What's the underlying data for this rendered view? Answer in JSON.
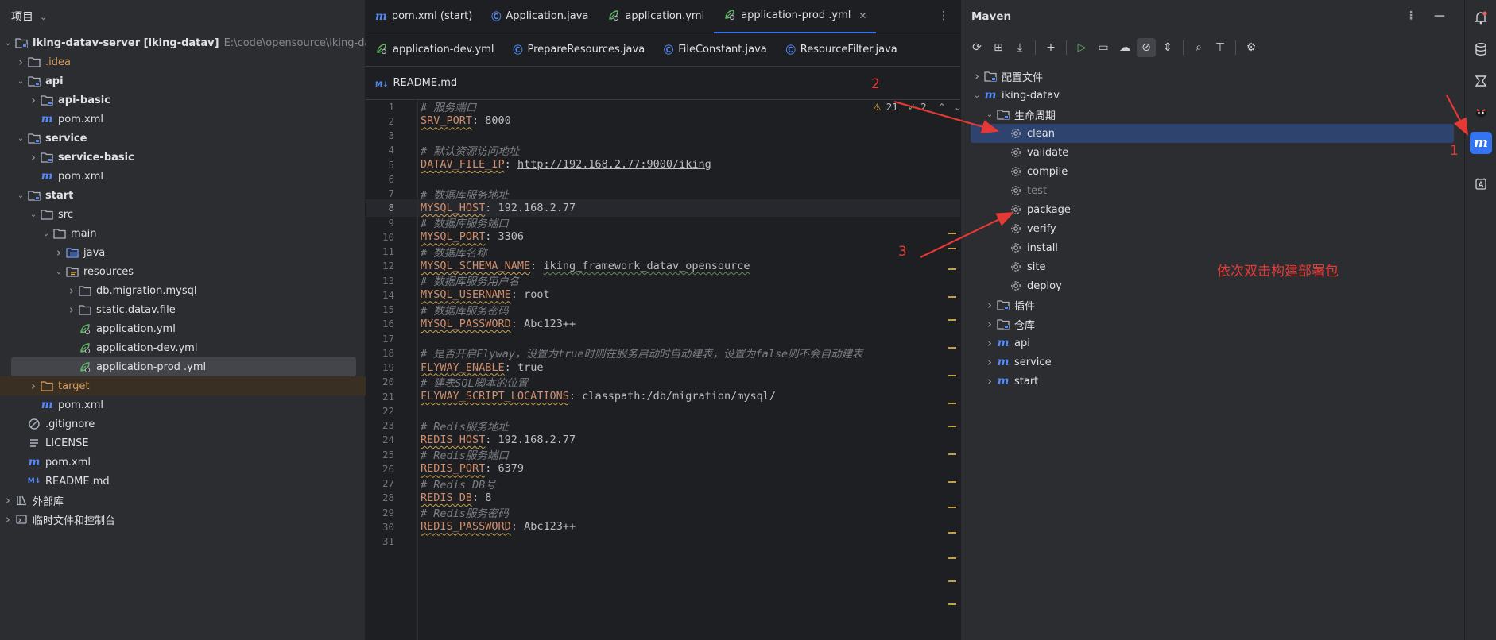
{
  "project_panel": {
    "title": "项目",
    "rows": [
      {
        "label": "iking-datav-server [iking-datav]",
        "path": "E:\\code\\opensource\\iking-datav-server",
        "depth": 0,
        "arrow": "down",
        "icon": "module-folder",
        "bold": true
      },
      {
        "label": ".idea",
        "depth": 1,
        "arrow": "right",
        "icon": "folder",
        "orange": true
      },
      {
        "label": "api",
        "depth": 1,
        "arrow": "down",
        "icon": "module-folder",
        "bold": true
      },
      {
        "label": "api-basic",
        "depth": 2,
        "arrow": "right",
        "icon": "module-folder",
        "bold": true
      },
      {
        "label": "pom.xml",
        "depth": 2,
        "arrow": "",
        "icon": "maven"
      },
      {
        "label": "service",
        "depth": 1,
        "arrow": "down",
        "icon": "module-folder",
        "bold": true
      },
      {
        "label": "service-basic",
        "depth": 2,
        "arrow": "right",
        "icon": "module-folder",
        "bold": true
      },
      {
        "label": "pom.xml",
        "depth": 2,
        "arrow": "",
        "icon": "maven"
      },
      {
        "label": "start",
        "depth": 1,
        "arrow": "down",
        "icon": "module-folder",
        "bold": true
      },
      {
        "label": "src",
        "depth": 2,
        "arrow": "down",
        "icon": "folder"
      },
      {
        "label": "main",
        "depth": 3,
        "arrow": "down",
        "icon": "folder"
      },
      {
        "label": "java",
        "depth": 4,
        "arrow": "right",
        "icon": "source-folder"
      },
      {
        "label": "resources",
        "depth": 4,
        "arrow": "down",
        "icon": "resource-folder"
      },
      {
        "label": "db.migration.mysql",
        "depth": 5,
        "arrow": "right",
        "icon": "folder"
      },
      {
        "label": "static.datav.file",
        "depth": 5,
        "arrow": "right",
        "icon": "folder"
      },
      {
        "label": "application.yml",
        "depth": 5,
        "arrow": "",
        "icon": "yaml"
      },
      {
        "label": "application-dev.yml",
        "depth": 5,
        "arrow": "",
        "icon": "yaml"
      },
      {
        "label": "application-prod .yml",
        "depth": 5,
        "arrow": "",
        "icon": "yaml",
        "selected": true
      },
      {
        "label": "target",
        "depth": 2,
        "arrow": "right",
        "icon": "folder-orange",
        "orange": true,
        "highlight": "target"
      },
      {
        "label": "pom.xml",
        "depth": 2,
        "arrow": "",
        "icon": "maven"
      },
      {
        "label": ".gitignore",
        "depth": 1,
        "arrow": "",
        "icon": "ignore"
      },
      {
        "label": "LICENSE",
        "depth": 1,
        "arrow": "",
        "icon": "text"
      },
      {
        "label": "pom.xml",
        "depth": 1,
        "arrow": "",
        "icon": "maven"
      },
      {
        "label": "README.md",
        "depth": 1,
        "arrow": "",
        "icon": "markdown"
      },
      {
        "label": "外部库",
        "depth": 0,
        "arrow": "right",
        "icon": "library"
      },
      {
        "label": "临时文件和控制台",
        "depth": 0,
        "arrow": "right",
        "icon": "console"
      }
    ]
  },
  "editor": {
    "tabs_row1": [
      {
        "label": "pom.xml (start)",
        "icon": "maven"
      },
      {
        "label": "Application.java",
        "icon": "class"
      },
      {
        "label": "application.yml",
        "icon": "yaml"
      },
      {
        "label": "application-prod .yml",
        "icon": "yaml",
        "active": true
      }
    ],
    "tabs_row2": [
      {
        "label": "application-dev.yml",
        "icon": "yaml"
      },
      {
        "label": "PrepareResources.java",
        "icon": "class"
      },
      {
        "label": "FileConstant.java",
        "icon": "class"
      },
      {
        "label": "ResourceFilter.java",
        "icon": "class"
      }
    ],
    "tabs_row3": [
      {
        "label": "README.md",
        "icon": "markdown"
      }
    ],
    "inspections": {
      "warnings": "21",
      "weak": "2"
    },
    "current_line": 8,
    "lines": [
      {
        "n": "1",
        "comment": "# 服务端口"
      },
      {
        "n": "2",
        "key": "SRV_PORT",
        "value": "8000"
      },
      {
        "n": "3"
      },
      {
        "n": "4",
        "comment": "# 默认资源访问地址"
      },
      {
        "n": "5",
        "key": "DATAV_FILE_IP",
        "value": "http://192.168.2.77:9000/iking",
        "url": true
      },
      {
        "n": "6"
      },
      {
        "n": "7",
        "comment": "# 数据库服务地址"
      },
      {
        "n": "8",
        "key": "MYSQL_HOST",
        "value": "192.168.2.77"
      },
      {
        "n": "9",
        "comment": "# 数据库服务端口"
      },
      {
        "n": "10",
        "key": "MYSQL_PORT",
        "value": "3306"
      },
      {
        "n": "11",
        "comment": "# 数据库名称"
      },
      {
        "n": "12",
        "key": "MYSQL_SCHEMA_NAME",
        "value": "iking_framework_datav_opensource",
        "spell": true
      },
      {
        "n": "13",
        "comment": "# 数据库服务用户名"
      },
      {
        "n": "14",
        "key": "MYSQL_USERNAME",
        "value": "root"
      },
      {
        "n": "15",
        "comment": "# 数据库服务密码"
      },
      {
        "n": "16",
        "key": "MYSQL_PASSWORD",
        "value": "Abc123++"
      },
      {
        "n": "17"
      },
      {
        "n": "18",
        "comment": "# 是否开启Flyway，设置为true时则在服务启动时自动建表，设置为false则不会自动建表"
      },
      {
        "n": "19",
        "key": "FLYWAY_ENABLE",
        "value": "true"
      },
      {
        "n": "20",
        "comment": "# 建表SQL脚本的位置"
      },
      {
        "n": "21",
        "key": "FLYWAY_SCRIPT_LOCATIONS",
        "value": "classpath:/db/migration/mysql/"
      },
      {
        "n": "22"
      },
      {
        "n": "23",
        "comment": "# Redis服务地址"
      },
      {
        "n": "24",
        "key": "REDIS_HOST",
        "value": "192.168.2.77"
      },
      {
        "n": "25",
        "comment": "# Redis服务端口"
      },
      {
        "n": "26",
        "key": "REDIS_PORT",
        "value": "6379"
      },
      {
        "n": "27",
        "comment": "# Redis DB号"
      },
      {
        "n": "28",
        "key": "REDIS_DB",
        "value": "8"
      },
      {
        "n": "29",
        "comment": "# Redis服务密码"
      },
      {
        "n": "30",
        "key": "REDIS_PASSWORD",
        "value": "Abc123++"
      },
      {
        "n": "31"
      }
    ]
  },
  "maven": {
    "title": "Maven",
    "rows": [
      {
        "label": "配置文件",
        "depth": 0,
        "arrow": "right",
        "icon": "profiles"
      },
      {
        "label": "iking-datav",
        "depth": 0,
        "arrow": "down",
        "icon": "maven"
      },
      {
        "label": "生命周期",
        "depth": 1,
        "arrow": "down",
        "icon": "lifecycle"
      },
      {
        "label": "clean",
        "depth": 2,
        "arrow": "",
        "icon": "gear",
        "selected": true
      },
      {
        "label": "validate",
        "depth": 2,
        "arrow": "",
        "icon": "gear"
      },
      {
        "label": "compile",
        "depth": 2,
        "arrow": "",
        "icon": "gear"
      },
      {
        "label": "test",
        "depth": 2,
        "arrow": "",
        "icon": "gear",
        "strike": true
      },
      {
        "label": "package",
        "depth": 2,
        "arrow": "",
        "icon": "gear"
      },
      {
        "label": "verify",
        "depth": 2,
        "arrow": "",
        "icon": "gear"
      },
      {
        "label": "install",
        "depth": 2,
        "arrow": "",
        "icon": "gear"
      },
      {
        "label": "site",
        "depth": 2,
        "arrow": "",
        "icon": "gear"
      },
      {
        "label": "deploy",
        "depth": 2,
        "arrow": "",
        "icon": "gear"
      },
      {
        "label": "插件",
        "depth": 1,
        "arrow": "right",
        "icon": "plugins"
      },
      {
        "label": "仓库",
        "depth": 1,
        "arrow": "right",
        "icon": "repositories"
      },
      {
        "label": "api",
        "depth": 1,
        "arrow": "right",
        "icon": "maven"
      },
      {
        "label": "service",
        "depth": 1,
        "arrow": "right",
        "icon": "maven"
      },
      {
        "label": "start",
        "depth": 1,
        "arrow": "right",
        "icon": "maven"
      }
    ],
    "toolbar": [
      "reload-icon",
      "add-project-icon",
      "download-icon",
      "add-icon",
      "run-icon",
      "execute-goal-icon",
      "offline-icon",
      "skip-tests-icon",
      "collapse-icon",
      "analyze-icon",
      "show-dependencies-icon",
      "settings-icon"
    ]
  },
  "annotations": {
    "label1": "1",
    "label2": "2",
    "label3": "3",
    "note": "依次双击构建部署包"
  },
  "colors": {
    "accent": "#3574f0",
    "annotation": "#e53935",
    "key": "#cf8e6d",
    "comment": "#7a7e85"
  }
}
